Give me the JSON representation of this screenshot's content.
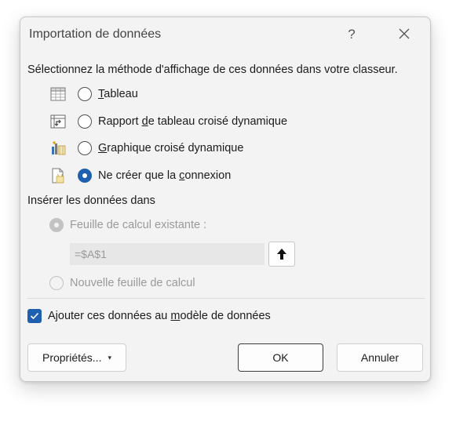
{
  "dialog": {
    "title": "Importation de données",
    "help_label": "?",
    "prompt": "Sélectionnez la méthode d'affichage de ces données dans votre classeur.",
    "options": [
      {
        "label_pre": "",
        "label_u": "T",
        "label_post": "ableau",
        "icon": "table-icon",
        "selected": false
      },
      {
        "label_pre": "Rapport ",
        "label_u": "d",
        "label_post": "e tableau croisé dynamique",
        "icon": "pivot-table-icon",
        "selected": false
      },
      {
        "label_pre": "",
        "label_u": "G",
        "label_post": "raphique croisé dynamique",
        "icon": "pivot-chart-icon",
        "selected": false
      },
      {
        "label_pre": "Ne créer que la ",
        "label_u": "c",
        "label_post": "onnexion",
        "icon": "connection-only-icon",
        "selected": true
      }
    ],
    "insert_label": "Insérer les données dans",
    "existing_sheet_label": "Feuille de calcul existante :",
    "cell_reference": "=$A$1",
    "new_sheet_label": "Nouvelle feuille de calcul",
    "add_to_model": {
      "pre": "Ajouter ces données au ",
      "u": "m",
      "post": "odèle de données",
      "checked": true
    },
    "buttons": {
      "properties": "Propriétés...",
      "ok": "OK",
      "cancel": "Annuler"
    },
    "accent_color": "#1f5fb0"
  }
}
